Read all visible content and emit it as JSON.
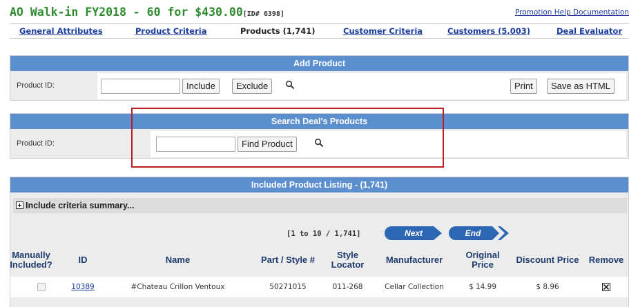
{
  "header": {
    "title": "AO Walk-in FY2018 - 60 for $430.00",
    "id_label": "[ID# 6398]",
    "help_link": "Promotion Help Documentation"
  },
  "tabs": [
    {
      "label": "General Attributes",
      "active": false
    },
    {
      "label": "Product Criteria",
      "active": false
    },
    {
      "label": "Products (1,741)",
      "active": true
    },
    {
      "label": "Customer Criteria",
      "active": false
    },
    {
      "label": "Customers (5,003)",
      "active": false
    },
    {
      "label": "Deal Evaluator",
      "active": false
    }
  ],
  "add_product": {
    "heading": "Add Product",
    "field_label": "Product ID:",
    "input_value": "",
    "include_label": "Include",
    "exclude_label": "Exclude",
    "print_label": "Print",
    "save_html_label": "Save as HTML"
  },
  "search_products": {
    "heading": "Search Deal's Products",
    "field_label": "Product ID:",
    "input_value": "",
    "find_label": "Find Product"
  },
  "listing": {
    "heading": "Included Product Listing - (1,741)",
    "summary_label": "Include criteria summary...",
    "pager_text": "[1 to 10 / 1,741]",
    "next_label": "Next",
    "end_label": "End",
    "columns": [
      "Manually Included?",
      "ID",
      "Name",
      "Part / Style #",
      "Style Locator",
      "Manufacturer",
      "Original Price",
      "Discount Price",
      "Remove"
    ],
    "rows": [
      {
        "manually_included": false,
        "id": "10389",
        "name": "#Chateau Crillon Ventoux",
        "part_style": "50271015",
        "style_locator": "011-268",
        "manufacturer": "Cellar Collection",
        "original_price": "$ 14.99",
        "discount_price": "$ 8.96",
        "remove": true
      }
    ]
  },
  "colors": {
    "accent": "#5b8fce",
    "title_green": "#2e8b2e",
    "link_blue": "#1a3c9c",
    "highlight_red": "#b8201f"
  }
}
